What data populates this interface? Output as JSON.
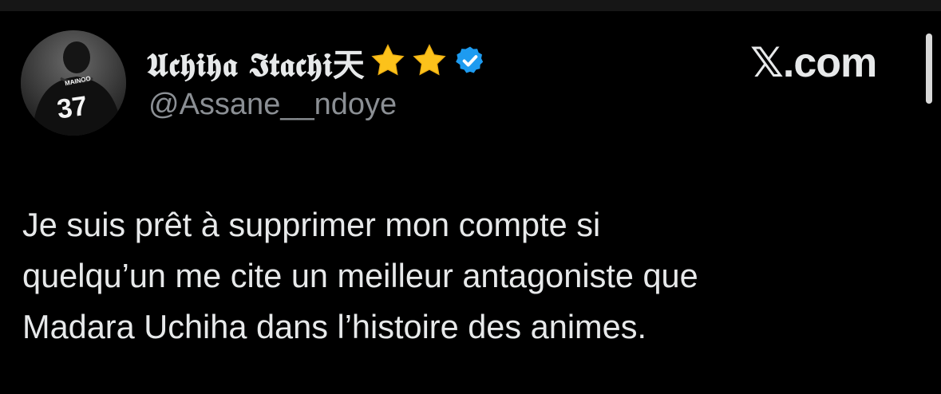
{
  "author": {
    "display_name": "𝖀𝖈𝖍𝖎𝖍𝖆 𝕴𝖙𝖆𝖈𝖍𝖎天",
    "handle": "@Assane__ndoye",
    "avatar_jersey_number": "37",
    "avatar_jersey_name": "MAINOO",
    "badges": [
      "star-icon",
      "star-icon",
      "verified-icon"
    ]
  },
  "brand": {
    "logo_text": "𝕏.com"
  },
  "tweet": {
    "lines": [
      "Je suis prêt à supprimer mon compte si",
      "quelqu’un me cite un meilleur antagoniste que",
      "Madara Uchiha dans l’histoire des animes."
    ]
  },
  "colors": {
    "background": "#000000",
    "text_primary": "#e7e9ea",
    "text_secondary": "#8b8f94",
    "verified_blue": "#1d9bf0",
    "star_yellow": "#fcc21b"
  }
}
